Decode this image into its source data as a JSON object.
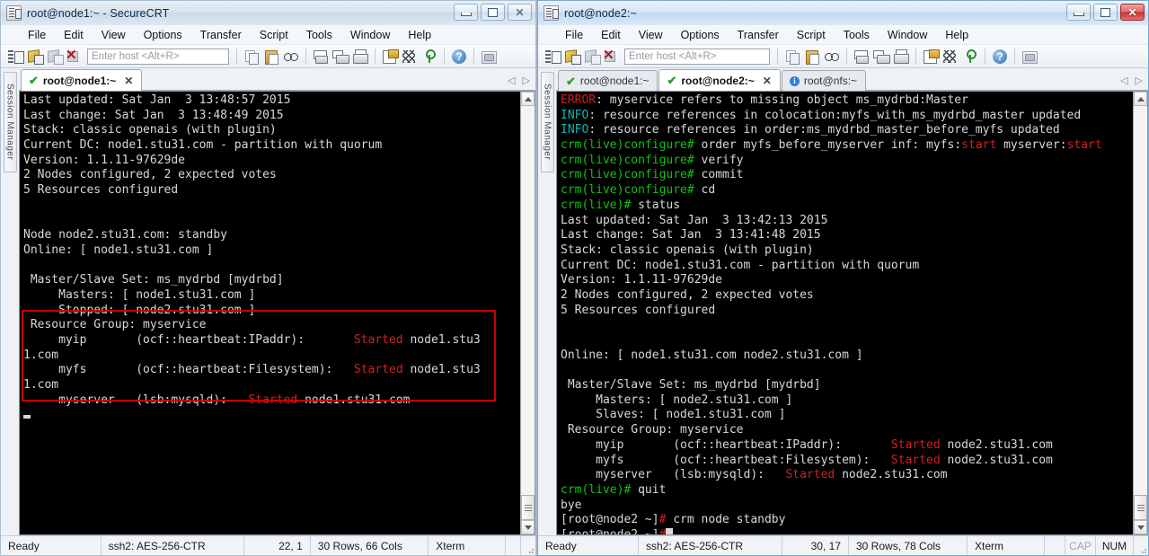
{
  "left_window": {
    "title": "root@node1:~ - SecureCRT",
    "title_icon": "securecrt-icon",
    "menus": [
      "File",
      "Edit",
      "View",
      "Options",
      "Transfer",
      "Script",
      "Tools",
      "Window",
      "Help"
    ],
    "toolbar": {
      "host_placeholder": "Enter host <Alt+R>",
      "icons": [
        "session-manager-icon",
        "connect-icon",
        "connect-sftp-icon",
        "disconnect-icon",
        "copy-icon",
        "paste-icon",
        "find-icon",
        "print-screen-icon",
        "print-selection-icon",
        "print-icon",
        "log-session-icon",
        "hex-view-icon",
        "key-icon",
        "help-icon",
        "arrange-layout-icon"
      ]
    },
    "side_strip_label": "Session Manager",
    "tabs": [
      {
        "label": "root@node1:~",
        "icon": "check-icon",
        "active": true,
        "closable": true
      }
    ],
    "window_buttons": {
      "minimize": "minimize-icon",
      "maximize": "maximize-icon",
      "close": "close-icon"
    },
    "terminal": {
      "lines": [
        [
          {
            "t": "Last updated: Sat Jan  3 13:48:57 2015",
            "c": "w"
          }
        ],
        [
          {
            "t": "Last change: Sat Jan  3 13:48:49 2015",
            "c": "w"
          }
        ],
        [
          {
            "t": "Stack: classic openais (with plugin)",
            "c": "w"
          }
        ],
        [
          {
            "t": "Current DC: node1.stu31.com - partition with quorum",
            "c": "w"
          }
        ],
        [
          {
            "t": "Version: 1.1.11-97629de",
            "c": "w"
          }
        ],
        [
          {
            "t": "2 Nodes configured, 2 expected votes",
            "c": "w"
          }
        ],
        [
          {
            "t": "5 Resources configured",
            "c": "w"
          }
        ],
        [
          {
            "t": "",
            "c": "w"
          }
        ],
        [
          {
            "t": "",
            "c": "w"
          }
        ],
        [
          {
            "t": "Node node2.stu31.com: standby",
            "c": "w"
          }
        ],
        [
          {
            "t": "Online: [ node1.stu31.com ]",
            "c": "w"
          }
        ],
        [
          {
            "t": "",
            "c": "w"
          }
        ],
        [
          {
            "t": " Master/Slave Set: ms_mydrbd [mydrbd]",
            "c": "w"
          }
        ],
        [
          {
            "t": "     Masters: [ node1.stu31.com ]",
            "c": "w"
          }
        ],
        [
          {
            "t": "     Stopped: [ node2.stu31.com ]",
            "c": "w"
          }
        ],
        [
          {
            "t": " Resource Group: myservice",
            "c": "w"
          }
        ],
        [
          {
            "t": "     myip       (ocf::heartbeat:IPaddr):       ",
            "c": "w"
          },
          {
            "t": "Started",
            "c": "r"
          },
          {
            "t": " node1.stu3",
            "c": "w"
          }
        ],
        [
          {
            "t": "1.com",
            "c": "w"
          }
        ],
        [
          {
            "t": "     myfs       (ocf::heartbeat:Filesystem):   ",
            "c": "w"
          },
          {
            "t": "Started",
            "c": "r"
          },
          {
            "t": " node1.stu3",
            "c": "w"
          }
        ],
        [
          {
            "t": "1.com",
            "c": "w"
          }
        ],
        [
          {
            "t": "     myserver   (lsb:mysqld):   ",
            "c": "w"
          },
          {
            "t": "Started",
            "c": "r"
          },
          {
            "t": " node1.stu31.com",
            "c": "w"
          }
        ],
        [
          {
            "t": "CURSOR_UNDER",
            "c": "cursor-under"
          }
        ]
      ],
      "highlight": {
        "color": "#cc0000",
        "note": "red-rectangle-around-resource-group"
      }
    },
    "status": {
      "ready": "Ready",
      "encryption": "ssh2: AES-256-CTR",
      "position": "22,  1",
      "dimensions": "30 Rows, 66 Cols",
      "emulation": "Xterm",
      "cap": "",
      "num": ""
    }
  },
  "right_window": {
    "title": "root@node2:~",
    "title_icon": "securecrt-icon",
    "menus": [
      "File",
      "Edit",
      "View",
      "Options",
      "Transfer",
      "Script",
      "Tools",
      "Window",
      "Help"
    ],
    "toolbar": {
      "host_placeholder": "Enter host <Alt+R>",
      "icons": [
        "session-manager-icon",
        "connect-icon",
        "connect-sftp-icon",
        "disconnect-icon",
        "copy-icon",
        "paste-icon",
        "find-icon",
        "print-screen-icon",
        "print-selection-icon",
        "print-icon",
        "log-session-icon",
        "hex-view-icon",
        "key-icon",
        "help-icon",
        "arrange-layout-icon"
      ]
    },
    "side_strip_label": "Session Manager",
    "tabs": [
      {
        "label": "root@node1:~",
        "icon": "check-icon",
        "active": false,
        "closable": false
      },
      {
        "label": "root@node2:~",
        "icon": "check-icon",
        "active": true,
        "closable": true
      },
      {
        "label": "root@nfs:~",
        "icon": "info-icon",
        "active": false,
        "closable": false
      }
    ],
    "window_buttons": {
      "minimize": "minimize-icon",
      "maximize": "maximize-icon",
      "close": "close-icon"
    },
    "terminal": {
      "lines": [
        [
          {
            "t": "ERROR",
            "c": "r"
          },
          {
            "t": ": myservice refers to missing object ms_mydrbd:Master",
            "c": "w"
          }
        ],
        [
          {
            "t": "INFO",
            "c": "c"
          },
          {
            "t": ": resource references in colocation:myfs_with_ms_mydrbd_master updated",
            "c": "w"
          }
        ],
        [
          {
            "t": "INFO",
            "c": "c"
          },
          {
            "t": ": resource references in order:ms_mydrbd_master_before_myfs updated",
            "c": "w"
          }
        ],
        [
          {
            "t": "crm(live)configure# ",
            "c": "g"
          },
          {
            "t": "order myfs_before_myserver inf: myfs:",
            "c": "w"
          },
          {
            "t": "start",
            "c": "r"
          },
          {
            "t": " myserver:",
            "c": "w"
          },
          {
            "t": "start",
            "c": "r"
          }
        ],
        [
          {
            "t": "crm(live)configure# ",
            "c": "g"
          },
          {
            "t": "verify",
            "c": "w"
          }
        ],
        [
          {
            "t": "crm(live)configure# ",
            "c": "g"
          },
          {
            "t": "commit",
            "c": "w"
          }
        ],
        [
          {
            "t": "crm(live)configure# ",
            "c": "g"
          },
          {
            "t": "cd",
            "c": "w"
          }
        ],
        [
          {
            "t": "crm(live)# ",
            "c": "g"
          },
          {
            "t": "status",
            "c": "w"
          }
        ],
        [
          {
            "t": "Last updated: Sat Jan  3 13:42:13 2015",
            "c": "w"
          }
        ],
        [
          {
            "t": "Last change: Sat Jan  3 13:41:48 2015",
            "c": "w"
          }
        ],
        [
          {
            "t": "Stack: classic openais (with plugin)",
            "c": "w"
          }
        ],
        [
          {
            "t": "Current DC: node1.stu31.com - partition with quorum",
            "c": "w"
          }
        ],
        [
          {
            "t": "Version: 1.1.11-97629de",
            "c": "w"
          }
        ],
        [
          {
            "t": "2 Nodes configured, 2 expected votes",
            "c": "w"
          }
        ],
        [
          {
            "t": "5 Resources configured",
            "c": "w"
          }
        ],
        [
          {
            "t": "",
            "c": "w"
          }
        ],
        [
          {
            "t": "",
            "c": "w"
          }
        ],
        [
          {
            "t": "Online: [ node1.stu31.com node2.stu31.com ]",
            "c": "w"
          }
        ],
        [
          {
            "t": "",
            "c": "w"
          }
        ],
        [
          {
            "t": " Master/Slave Set: ms_mydrbd [mydrbd]",
            "c": "w"
          }
        ],
        [
          {
            "t": "     Masters: [ node2.stu31.com ]",
            "c": "w"
          }
        ],
        [
          {
            "t": "     Slaves: [ node1.stu31.com ]",
            "c": "w"
          }
        ],
        [
          {
            "t": " Resource Group: myservice",
            "c": "w"
          }
        ],
        [
          {
            "t": "     myip       (ocf::heartbeat:IPaddr):       ",
            "c": "w"
          },
          {
            "t": "Started",
            "c": "r"
          },
          {
            "t": " node2.stu31.com",
            "c": "w"
          }
        ],
        [
          {
            "t": "     myfs       (ocf::heartbeat:Filesystem):   ",
            "c": "w"
          },
          {
            "t": "Started",
            "c": "r"
          },
          {
            "t": " node2.stu31.com",
            "c": "w"
          }
        ],
        [
          {
            "t": "     myserver   (lsb:mysqld):   ",
            "c": "w"
          },
          {
            "t": "Started",
            "c": "r"
          },
          {
            "t": " node2.stu31.com",
            "c": "w"
          }
        ],
        [
          {
            "t": "crm(live)# ",
            "c": "g"
          },
          {
            "t": "quit",
            "c": "w"
          }
        ],
        [
          {
            "t": "bye",
            "c": "w"
          }
        ],
        [
          {
            "t": "[root@node2 ~]",
            "c": "w"
          },
          {
            "t": "#",
            "c": "r"
          },
          {
            "t": " crm node standby",
            "c": "w"
          }
        ],
        [
          {
            "t": "[root@node2 ~]",
            "c": "w"
          },
          {
            "t": "#",
            "c": "r"
          },
          {
            "t": "CURSOR_BLOCK",
            "c": "cursor-block"
          }
        ]
      ]
    },
    "status": {
      "ready": "Ready",
      "encryption": "ssh2: AES-256-CTR",
      "position": "30,  17",
      "dimensions": "30 Rows, 78 Cols",
      "emulation": "Xterm",
      "cap": "CAP",
      "num": "NUM"
    }
  },
  "colors": {
    "terminal_bg": "#000000",
    "terminal_fg": "#d8d8d8",
    "accent_red": "#cc2222",
    "accent_green": "#12c212",
    "accent_cyan": "#12b6b6",
    "highlight_box": "#cc0000"
  }
}
